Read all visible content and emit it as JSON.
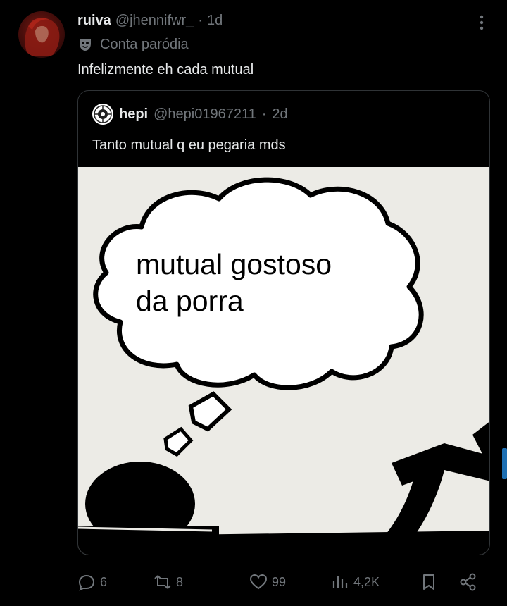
{
  "tweet": {
    "display_name": "ruiva",
    "handle": "@jhennifwr_",
    "separator": "·",
    "time": "1d",
    "parody_label": "Conta paródia",
    "text": "Infelizmente eh cada mutual"
  },
  "quoted": {
    "display_name": "hepi",
    "handle": "@hepi01967211",
    "separator": "·",
    "time": "2d",
    "text": "Tanto mutual q eu pegaria mds",
    "image_text": "mutual gostoso\nda porra"
  },
  "actions": {
    "replies": "6",
    "retweets": "8",
    "likes": "99",
    "views": "4,2K"
  },
  "icons": {
    "more": "more-vertical-icon",
    "parody": "theater-mask-icon",
    "reply": "reply-icon",
    "retweet": "retweet-icon",
    "like": "heart-icon",
    "views": "views-icon",
    "bookmark": "bookmark-icon",
    "share": "share-icon"
  },
  "colors": {
    "background": "#000000",
    "primary_text": "#e7e9ea",
    "secondary_text": "#71767b",
    "border": "#2f3336",
    "scroll_accent": "#1d6fb3"
  }
}
